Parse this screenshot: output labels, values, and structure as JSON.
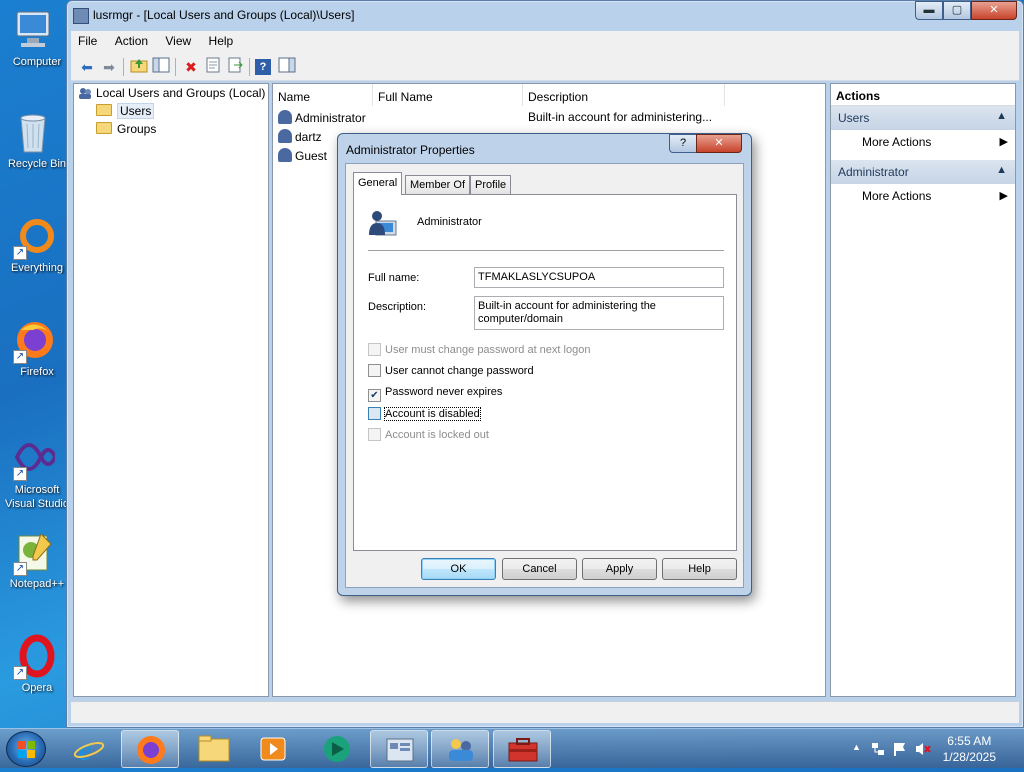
{
  "desktop": {
    "icons": [
      {
        "label": "Computer",
        "icon": "computer-icon"
      },
      {
        "label": "Recycle Bin",
        "icon": "recycle-bin-icon"
      },
      {
        "label": "Everything",
        "icon": "everything-icon"
      },
      {
        "label": "Firefox",
        "icon": "firefox-icon"
      },
      {
        "label": "Microsoft Visual Studio",
        "icon": "visual-studio-icon"
      },
      {
        "label": "Notepad++",
        "icon": "notepadpp-icon"
      },
      {
        "label": "Opera",
        "icon": "opera-icon"
      }
    ]
  },
  "window": {
    "title": "lusrmgr - [Local Users and Groups (Local)\\Users]",
    "caption_buttons": {
      "minimize": "▬",
      "maximize": "▢",
      "close": "✕"
    },
    "menu": [
      "File",
      "Action",
      "View",
      "Help"
    ],
    "tree": {
      "root": "Local Users and Groups (Local)",
      "children": [
        "Users",
        "Groups"
      ],
      "selected": "Users"
    },
    "list": {
      "columns": [
        "Name",
        "Full Name",
        "Description"
      ],
      "rows": [
        {
          "name": "Administrator",
          "full_name": "",
          "description": "Built-in account for administering..."
        },
        {
          "name": "dartz",
          "full_name": "",
          "description": ""
        },
        {
          "name": "Guest",
          "full_name": "",
          "description": ""
        }
      ]
    },
    "actions": {
      "header": "Actions",
      "groups": [
        {
          "title": "Users",
          "items": [
            "More Actions"
          ]
        },
        {
          "title": "Administrator",
          "items": [
            "More Actions"
          ]
        }
      ]
    }
  },
  "dialog": {
    "title": "Administrator Properties",
    "help_glyph": "?",
    "close_glyph": "✕",
    "tabs": [
      "General",
      "Member Of",
      "Profile"
    ],
    "active_tab": "General",
    "user_name": "Administrator",
    "fields": {
      "full_name_label": "Full name:",
      "full_name_value": "TFMAKLASLYCSUPOA",
      "description_label": "Description:",
      "description_value": "Built-in account for administering the\ncomputer/domain"
    },
    "checkboxes": [
      {
        "label": "User must change password at next logon",
        "checked": false,
        "enabled": false
      },
      {
        "label": "User cannot change password",
        "checked": false,
        "enabled": true
      },
      {
        "label": "Password never expires",
        "checked": true,
        "enabled": true
      },
      {
        "label": "Account is disabled",
        "checked": false,
        "enabled": true,
        "focused": true
      },
      {
        "label": "Account is locked out",
        "checked": false,
        "enabled": false
      }
    ],
    "buttons": [
      "OK",
      "Cancel",
      "Apply",
      "Help"
    ]
  },
  "taskbar": {
    "clock_time": "6:55 AM",
    "clock_date": "1/28/2025",
    "tray_arrow": "▲"
  },
  "colors": {
    "accent": "#3c7fb1",
    "desktop": "#1a6fc0",
    "close_button": "#c7442c"
  }
}
